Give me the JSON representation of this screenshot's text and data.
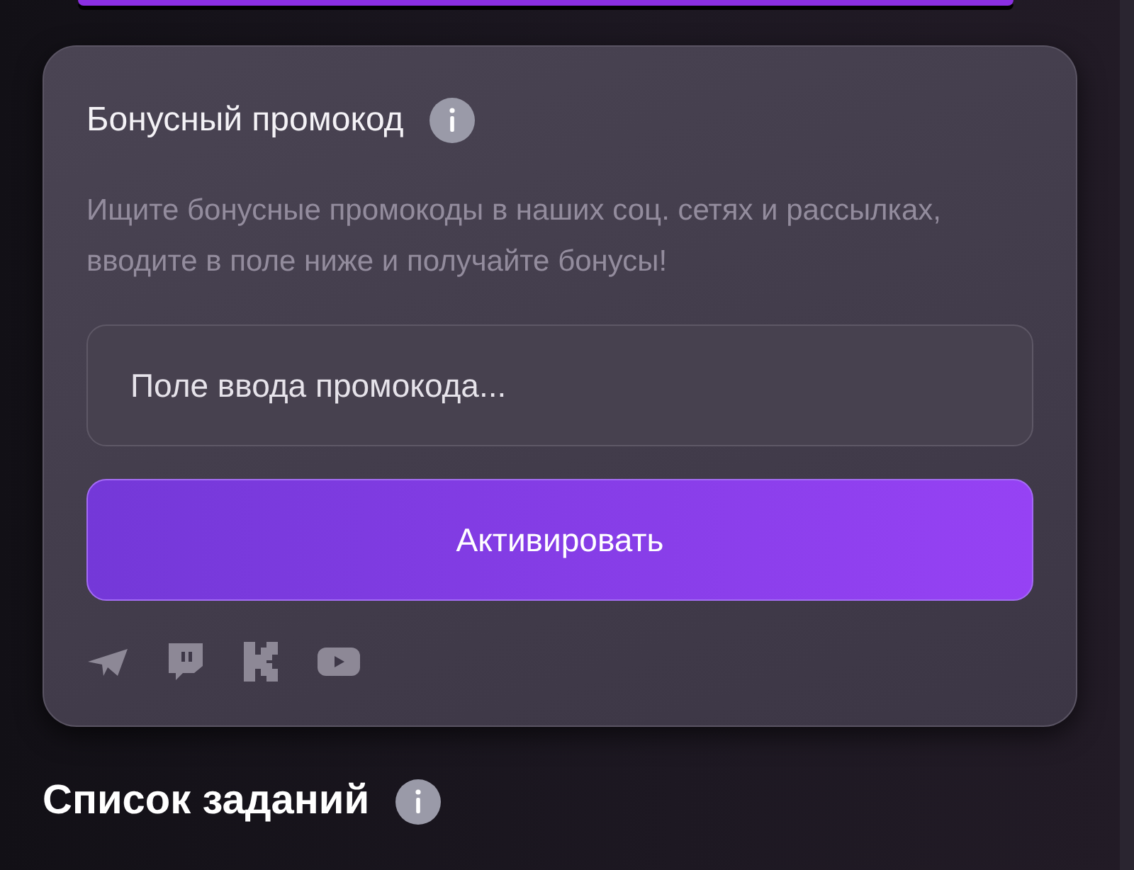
{
  "promo": {
    "title": "Бонусный промокод",
    "description": "Ищите бонусные промокоды в наших соц. сетях и рассылках, вводите в поле ниже и получайте бонусы!",
    "input": {
      "placeholder": "Поле ввода промокода..."
    },
    "button": "Активировать",
    "socials": [
      {
        "kind": "telegram"
      },
      {
        "kind": "twitch"
      },
      {
        "kind": "k"
      },
      {
        "kind": "youtube"
      }
    ]
  },
  "tasks": {
    "title": "Список заданий"
  }
}
